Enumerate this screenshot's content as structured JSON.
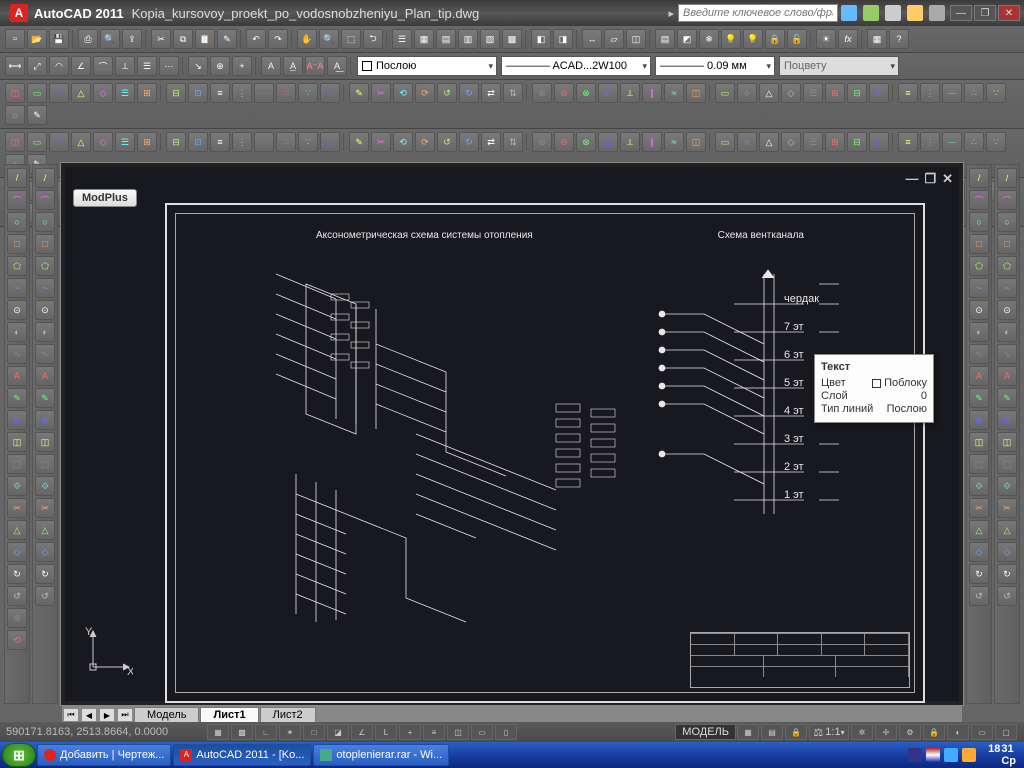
{
  "title": {
    "app": "AutoCAD 2011",
    "file": "Kopia_kursovoy_proekt_po_vodosnobzheniyu_Plan_tip.dwg",
    "search_placeholder": "Введите ключевое слово/фразу"
  },
  "dropdowns": {
    "layer": "Послою",
    "linetype": "———— ACAD...2W100",
    "lineweight": "———— 0.09 мм",
    "color": "Поцвету"
  },
  "drawing": {
    "modplus": "ModPlus",
    "heading1": "Аксонометрическая схема системы отопления",
    "heading2": "Схема вентканала",
    "vent_labels": {
      "attic": "чердак",
      "f7": "7 эт",
      "f6": "6 эт",
      "f5": "5 эт",
      "f4": "4 эт",
      "f3": "3 эт",
      "f2": "2 эт",
      "f1": "1 эт"
    }
  },
  "tooltip": {
    "header": "Текст",
    "rows": [
      {
        "k": "Цвет",
        "v": "Поблоку",
        "swatch": true
      },
      {
        "k": "Слой",
        "v": "0"
      },
      {
        "k": "Тип линий",
        "v": "Послою"
      }
    ]
  },
  "tabs": {
    "model": "Модель",
    "l1": "Лист1",
    "l2": "Лист2"
  },
  "status": {
    "coords": "590171.8163, 2513.8664, 0.0000",
    "model": "МОДЕЛЬ",
    "scale": "1:1"
  },
  "taskbar": {
    "items": [
      "Добавить | Чертеж...",
      "AutoCAD 2011 - [Ko...",
      "otoplenierar.rar - Wi..."
    ],
    "clock_h": "18",
    "clock_m": "31",
    "clock_d": "Ср"
  }
}
